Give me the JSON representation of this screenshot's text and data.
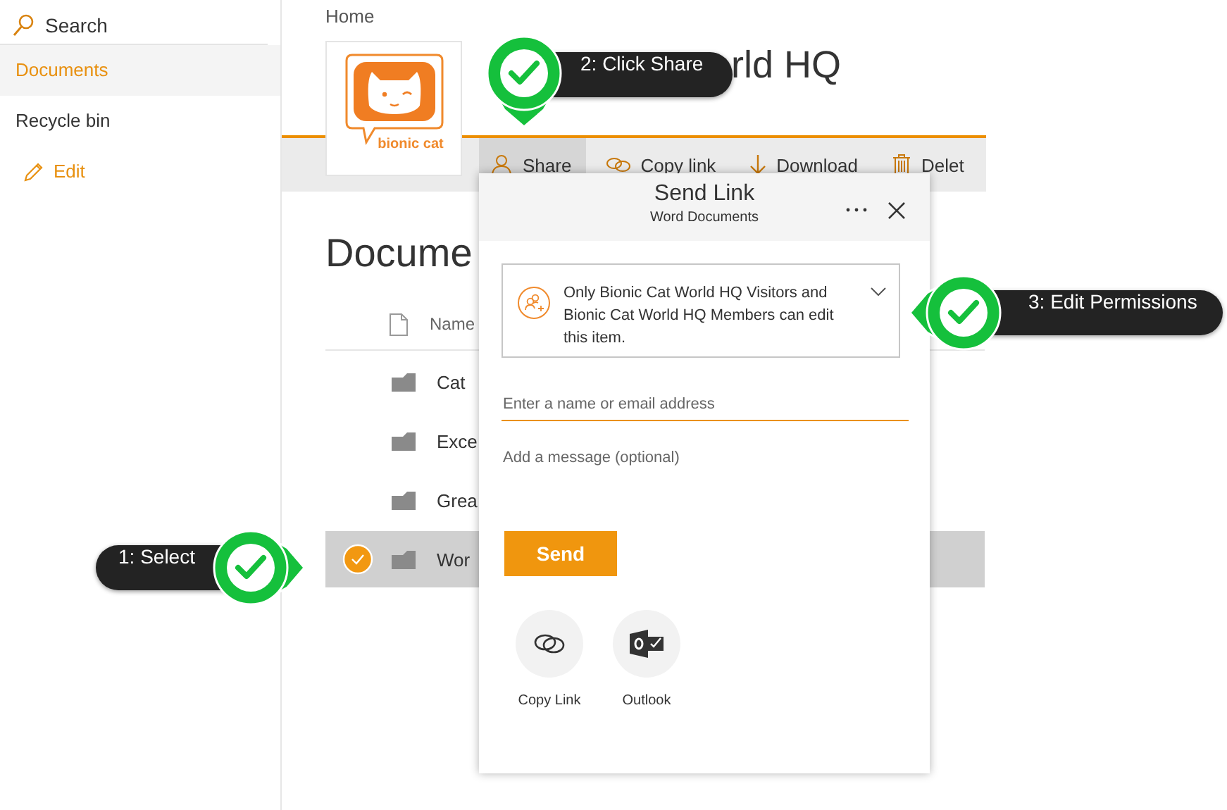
{
  "sidebar": {
    "search": {
      "placeholder": "Search"
    },
    "items": [
      {
        "label": "Documents",
        "selected": true
      },
      {
        "label": "Recycle bin",
        "selected": false
      }
    ],
    "edit_link": "Edit"
  },
  "breadcrumb": "Home",
  "site": {
    "logo_text": "bionic cat",
    "title": "rld HQ"
  },
  "toolbar": [
    {
      "label": "Share",
      "kind": "share",
      "selected": true
    },
    {
      "label": "Copy link",
      "kind": "link",
      "selected": false
    },
    {
      "label": "Download",
      "kind": "download",
      "selected": false
    },
    {
      "label": "Delet",
      "kind": "delete",
      "selected": false
    }
  ],
  "library": {
    "heading": "Docume",
    "name_column": "Name",
    "rows": [
      {
        "name": "Cat",
        "selected": false
      },
      {
        "name": "Exce",
        "selected": false
      },
      {
        "name": "Grea",
        "selected": false
      },
      {
        "name": "Wor",
        "selected": true
      }
    ]
  },
  "send_link": {
    "title": "Send Link",
    "subtitle": "Word Documents",
    "permission": "Only Bionic Cat World HQ Visitors and Bionic Cat World HQ Members can edit this item.",
    "recipient": {
      "placeholder": "Enter a name or email address"
    },
    "message": {
      "placeholder": "Add a message (optional)"
    },
    "send": "Send",
    "options": [
      {
        "label": "Copy Link",
        "kind": "link"
      },
      {
        "label": "Outlook",
        "kind": "outlook"
      }
    ]
  },
  "callouts": [
    {
      "label": "1: Select",
      "kind": "right"
    },
    {
      "label": "2: Click Share",
      "kind": "down"
    },
    {
      "label": "3: Edit Permissions",
      "kind": "left"
    }
  ]
}
